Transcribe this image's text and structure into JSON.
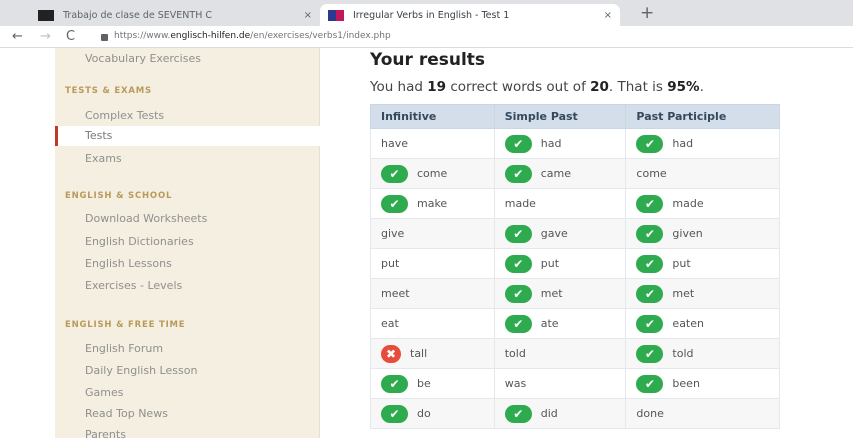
{
  "browser": {
    "tabs": [
      {
        "title": "Trabajo de clase de SEVENTH C",
        "close": "×"
      },
      {
        "title": "Irregular Verbs in English - Test 1",
        "close": "×"
      }
    ],
    "new_tab": "+",
    "nav": {
      "back": "←",
      "forward": "→",
      "reload": "C"
    },
    "url_prefix": "https://www.",
    "url_domain": "englisch-hilfen.de",
    "url_path": "/en/exercises/verbs1/index.php"
  },
  "sidebar": {
    "top_item": "Vocabulary Exercises",
    "sections": [
      {
        "heading": "TESTS & EXAMS",
        "items": [
          "Complex Tests",
          "Tests",
          "Exams"
        ]
      },
      {
        "heading": "ENGLISH & SCHOOL",
        "items": [
          "Download Worksheets",
          "English Dictionaries",
          "English Lessons",
          "Exercises - Levels"
        ]
      },
      {
        "heading": "ENGLISH & FREE TIME",
        "items": [
          "English Forum",
          "Daily English Lesson",
          "Games",
          "Read Top News",
          "Parents"
        ]
      }
    ],
    "active_item": "Tests"
  },
  "main": {
    "title": "Your results",
    "summary": {
      "part1": "You had ",
      "correct": "19",
      "part2": " correct words out of ",
      "total": "20",
      "part3": ". That is ",
      "percent": "95%",
      "part4": "."
    },
    "table": {
      "headers": [
        "Infinitive",
        "Simple Past",
        "Past Participle"
      ],
      "rows": [
        [
          {
            "text": "have",
            "mark": "none"
          },
          {
            "text": "had",
            "mark": "ok"
          },
          {
            "text": "had",
            "mark": "ok"
          }
        ],
        [
          {
            "text": "come",
            "mark": "ok"
          },
          {
            "text": "came",
            "mark": "ok"
          },
          {
            "text": "come",
            "mark": "none"
          }
        ],
        [
          {
            "text": "make",
            "mark": "ok"
          },
          {
            "text": "made",
            "mark": "none"
          },
          {
            "text": "made",
            "mark": "ok"
          }
        ],
        [
          {
            "text": "give",
            "mark": "none"
          },
          {
            "text": "gave",
            "mark": "ok"
          },
          {
            "text": "given",
            "mark": "ok"
          }
        ],
        [
          {
            "text": "put",
            "mark": "none"
          },
          {
            "text": "put",
            "mark": "ok"
          },
          {
            "text": "put",
            "mark": "ok"
          }
        ],
        [
          {
            "text": "meet",
            "mark": "none"
          },
          {
            "text": "met",
            "mark": "ok"
          },
          {
            "text": "met",
            "mark": "ok"
          }
        ],
        [
          {
            "text": "eat",
            "mark": "none"
          },
          {
            "text": "ate",
            "mark": "ok"
          },
          {
            "text": "eaten",
            "mark": "ok"
          }
        ],
        [
          {
            "text": "tall",
            "mark": "bad"
          },
          {
            "text": "told",
            "mark": "none"
          },
          {
            "text": "told",
            "mark": "ok"
          }
        ],
        [
          {
            "text": "be",
            "mark": "ok"
          },
          {
            "text": "was",
            "mark": "none"
          },
          {
            "text": "been",
            "mark": "ok"
          }
        ],
        [
          {
            "text": "do",
            "mark": "ok"
          },
          {
            "text": "did",
            "mark": "ok"
          },
          {
            "text": "done",
            "mark": "none"
          }
        ]
      ]
    }
  },
  "colors": {
    "sidebar_bg": "#f5efe2",
    "heading": "#b99a5b",
    "active_marker": "#c0392b",
    "correct": "#2eaa4f",
    "wrong": "#e74c3c",
    "table_header_bg": "#d3deea"
  },
  "icons": {
    "correct": "check-icon",
    "wrong": "cross-icon"
  }
}
